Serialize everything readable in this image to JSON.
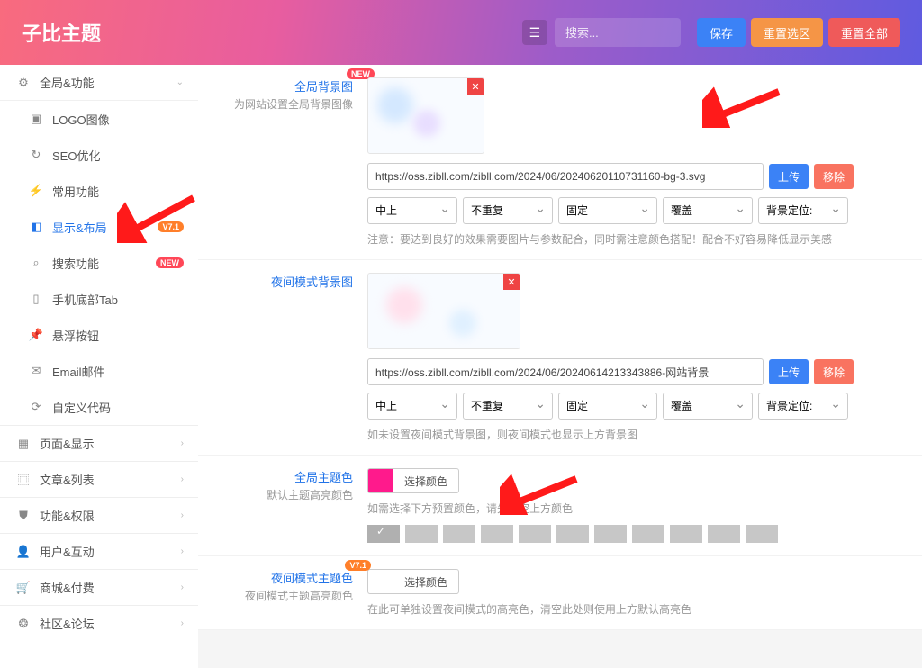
{
  "header": {
    "title": "子比主题",
    "search_placeholder": "搜索...",
    "save": "保存",
    "reset_section": "重置选区",
    "reset_all": "重置全部"
  },
  "sidebar": {
    "top": {
      "label": "全局&功能"
    },
    "sub": [
      {
        "icon": "image",
        "label": "LOGO图像"
      },
      {
        "icon": "seo",
        "label": "SEO优化"
      },
      {
        "icon": "bolt",
        "label": "常用功能"
      },
      {
        "icon": "layout",
        "label": "显示&布局",
        "active": true,
        "badge": "V7.1",
        "badge_type": "ver"
      },
      {
        "icon": "search",
        "label": "搜索功能",
        "badge": "NEW",
        "badge_type": "new"
      },
      {
        "icon": "mobile",
        "label": "手机底部Tab"
      },
      {
        "icon": "pin",
        "label": "悬浮按钮"
      },
      {
        "icon": "mail",
        "label": "Email邮件"
      },
      {
        "icon": "code",
        "label": "自定义代码"
      }
    ],
    "groups": [
      {
        "icon": "calendar",
        "label": "页面&显示"
      },
      {
        "icon": "map",
        "label": "文章&列表"
      },
      {
        "icon": "shield",
        "label": "功能&权限"
      },
      {
        "icon": "user",
        "label": "用户&互动"
      },
      {
        "icon": "cart",
        "label": "商城&付费"
      },
      {
        "icon": "globe",
        "label": "社区&论坛"
      }
    ]
  },
  "sections": {
    "bg": {
      "label": "全局背景图",
      "badge": "NEW",
      "sub": "为网站设置全局背景图像",
      "url": "https://oss.zibll.com/zibll.com/2024/06/20240620110731160-bg-3.svg",
      "upload": "上传",
      "remove": "移除",
      "sel_pos": "中上",
      "sel_repeat": "不重复",
      "sel_attach": "固定",
      "sel_size": "覆盖",
      "sel_loc": "背景定位:",
      "hint": "注意：要达到良好的效果需要图片与参数配合，同时需注意颜色搭配！配合不好容易降低显示美感"
    },
    "night_bg": {
      "label": "夜间模式背景图",
      "url": "https://oss.zibll.com/zibll.com/2024/06/20240614213343886-网站背景",
      "upload": "上传",
      "remove": "移除",
      "sel_pos": "中上",
      "sel_repeat": "不重复",
      "sel_attach": "固定",
      "sel_size": "覆盖",
      "sel_loc": "背景定位:",
      "hint": "如未设置夜间模式背景图，则夜间模式也显示上方背景图"
    },
    "theme_color": {
      "label": "全局主题色",
      "sub": "默认主题高亮颜色",
      "btn": "选择颜色",
      "hint": "如需选择下方预置颜色，请先清空上方颜色"
    },
    "night_color": {
      "label": "夜间模式主题色",
      "badge": "V7.1",
      "sub": "夜间模式主题高亮颜色",
      "btn": "选择颜色",
      "hint": "在此可单独设置夜间模式的高亮色，清空此处则使用上方默认高亮色"
    }
  }
}
